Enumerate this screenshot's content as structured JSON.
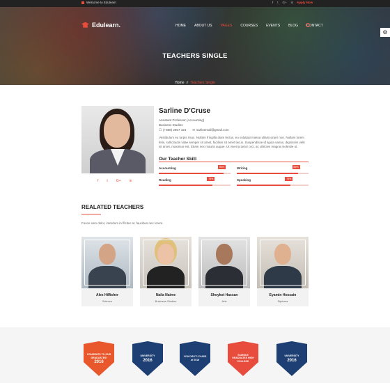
{
  "topbar": {
    "welcome": "Welcome to Edulearn",
    "socials": [
      "f",
      "t",
      "G+",
      "in"
    ],
    "apply": "Apply Now"
  },
  "logo": {
    "name": "Edulearn."
  },
  "nav": {
    "items": [
      "HOME",
      "ABOUT US",
      "PAGES",
      "COURSES",
      "EVENTS",
      "BLOG",
      "CONTACT"
    ],
    "active": "PAGES"
  },
  "hero": {
    "title": "TEACHERS SINGLE",
    "breadcrumb_home": "Home",
    "breadcrumb_sep": "//",
    "breadcrumb_current": "Teachers Single"
  },
  "profile": {
    "name": "Sarline D'Cruse",
    "role": "Assistant Professor (Accounting)",
    "department": "Business Studies",
    "phone": "(+888) 2957 424",
    "email": "sarlinemail@gmail.com",
    "bio": "Vestibulum eu turpis risus. Nullam fringilla diam lectus, eu volutpat massa ullamcorper non. Nullam lorem felis, sollicitudin vitae semper sit amet, facilisis sit amet lacus. Suspendisse id ligula varius, dignissim velit sit amet, maximus est. Etiam nec mauris augue. Ut viverra tortor orci, ac ultricies magna molestie ut.",
    "socials": [
      "f",
      "t",
      "G+",
      "in"
    ]
  },
  "skills": {
    "title": "Our Teacher Skill:",
    "items": [
      {
        "label": "Accounting",
        "value": 90,
        "badge": "90%"
      },
      {
        "label": "Writing",
        "value": 85,
        "badge": "85%"
      },
      {
        "label": "Reading",
        "value": 75,
        "badge": "75%"
      },
      {
        "label": "Speaking",
        "value": 75,
        "badge": "75%"
      }
    ]
  },
  "related": {
    "title": "REALATED TEACHERS",
    "description": "Fusce sem dolor, interdum in fficitur at, faucibus nec lorem.",
    "teachers": [
      {
        "name": "Alex Hilfisher",
        "dept": "Science"
      },
      {
        "name": "Naila Naime",
        "dept": "Business Studies"
      },
      {
        "name": "Shoykot Hassan",
        "dept": "Arts"
      },
      {
        "name": "Eyamin Hossain",
        "dept": "Diploma"
      }
    ]
  },
  "badges": [
    {
      "t1": "CONGRATS TO OUR GRADUATES!",
      "t2": "2016",
      "color": "#e8582c"
    },
    {
      "t1": "UNIVERSITY",
      "t2": "2016",
      "color": "#1d3f73"
    },
    {
      "t1": "YOU DID IT! CLASS of 2016",
      "t2": "",
      "color": "#1d3f73"
    },
    {
      "t1": "SCIENCE GRADUATES HIGH COLLEGE",
      "t2": "",
      "color": "#e74c3c"
    },
    {
      "t1": "UNIVERSITY",
      "t2": "2016",
      "color": "#1d3f73"
    }
  ]
}
